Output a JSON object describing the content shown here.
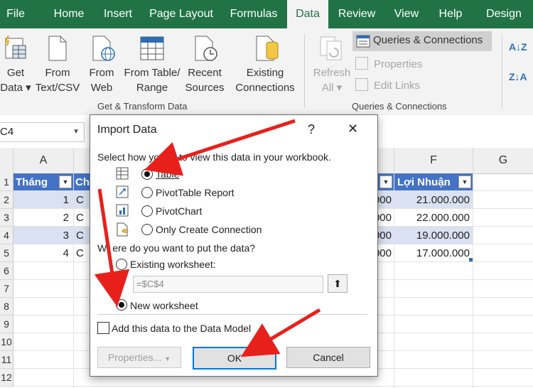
{
  "menu": [
    "File",
    "Home",
    "Insert",
    "Page Layout",
    "Formulas",
    "Data",
    "Review",
    "View",
    "Help",
    "Design"
  ],
  "ribbon": {
    "get_data_top": "Get",
    "get_data_bot": "Data ▾",
    "from_text_top": "From",
    "from_text_bot": "Text/CSV",
    "from_web_top": "From",
    "from_web_bot": "Web",
    "from_table_top": "From Table/",
    "from_table_bot": "Range",
    "recent_top": "Recent",
    "recent_bot": "Sources",
    "existing_top": "Existing",
    "existing_bot": "Connections",
    "group1": "Get & Transform Data",
    "refresh_top": "Refresh",
    "refresh_bot": "All ▾",
    "queries": "Queries & Connections",
    "properties": "Properties",
    "edit_links": "Edit Links",
    "group2": "Queries & Connections",
    "sort_az": "A↓Z",
    "sort_za": "Z↓A"
  },
  "namebox": "C4",
  "columns": [
    "A",
    "",
    "",
    "",
    "",
    "F",
    "G"
  ],
  "rows": [
    "1",
    "2",
    "3",
    "4",
    "5",
    "6",
    "7",
    "8",
    "9",
    "10",
    "11",
    "12"
  ],
  "table": {
    "header_a": "Tháng",
    "header_c": "Ch",
    "header_f": "Lợi Nhuận",
    "a_values": [
      "1",
      "2",
      "3",
      "4"
    ],
    "c_values": [
      "C",
      "C",
      "C",
      "C"
    ],
    "e_values": [
      "000",
      "000",
      "000",
      "000"
    ],
    "f_values": [
      "21.000.000",
      "22.000.000",
      "19.000.000",
      "17.000.000"
    ]
  },
  "dialog": {
    "title": "Import Data",
    "help": "?",
    "close": "✕",
    "prompt1_a": "Select how yo",
    "prompt1_b": "t to view this data in your workbook.",
    "opt_table": "Table",
    "opt_pivot_table": "PivotTable Report",
    "opt_pivot_chart": "PivotChart",
    "opt_connection": "Only Create Connection",
    "prompt2_a": "W",
    "prompt2_b": "ere do you want to put the data?",
    "opt_existing": "Existing worksheet:",
    "range_value": "=$C$4",
    "opt_new": "New worksheet",
    "data_model": "Add this data to the Data Model",
    "btn_properties": "Properties...",
    "btn_ok": "OK",
    "btn_cancel": "Cancel"
  },
  "colors": {
    "excel_green": "#217346",
    "table_header": "#4472c4",
    "band": "#d9e1f2",
    "arrow": "#e8201c"
  }
}
